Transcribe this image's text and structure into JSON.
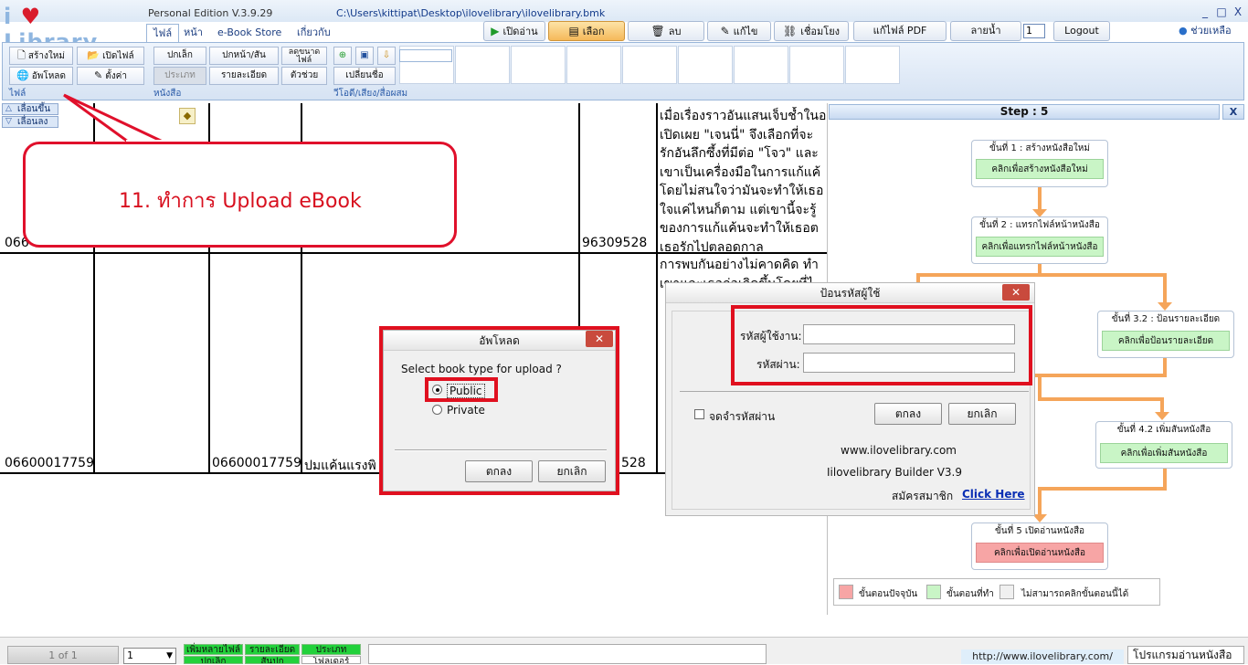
{
  "app": {
    "logo_prefix": "i",
    "logo_word": "Library",
    "edition": "Personal Edition V.3.9.29",
    "file_path": "C:\\Users\\kittipat\\Desktop\\ilovelibrary\\ilovelibrary.bmk",
    "win_minimize": "_",
    "win_restore": "□",
    "win_close": "X"
  },
  "tabs": [
    "ไฟล์",
    "หน้า",
    "e-Book Store",
    "เกี่ยวกับ"
  ],
  "toolbar": {
    "open_read": "เปิดอ่าน",
    "select": "เลือก",
    "delete": "ลบ",
    "edit": "แก้ไข",
    "link": "เชื่อมโยง",
    "edit_pdf": "แก้ไฟล์ PDF",
    "watermark": "ลายน้ำ",
    "page_value": "1",
    "logout": "Logout",
    "help": "ช่วยเหลือ"
  },
  "ribbon": {
    "file_group": {
      "label": "ไฟล์",
      "new": "สร้างใหม่",
      "open": "เปิดไฟล์",
      "upload": "อัพโหลด",
      "settings": "ตั้งค่า"
    },
    "book_group": {
      "label": "หนังสือ",
      "small": "ปกเล็ก",
      "cover": "ปกหน้า/สัน",
      "shrink": "ลดขนาด ไฟล์",
      "type": "ประเภท",
      "detail": "รายละเอียด",
      "helper": "ตัวช่วย"
    },
    "media_group": {
      "label": "วีโอดี/เสียง/สื่อผสม",
      "rename": "เปลี่ยนชื่อ"
    }
  },
  "grid": {
    "move_up": "เลื่อนขึ้น",
    "move_down": "เลื่อนลง",
    "row1_code": "066",
    "row1_barcode": "96309528",
    "row2_code_a": "06600017759",
    "row2_code_b": "06600017759",
    "row2_title": "ปมแค้นแรงพิ",
    "row2_barcode": "528",
    "desc_lines": [
      "เมื่อเรื่องราวอันแสนเจ็บช้ำในอ",
      "เปิดเผย \"เจนนี่\" จึงเลือกที่จะ",
      "รักอันลึกซึ้งที่มีต่อ \"โจว\" และ",
      "เขาเป็นเครื่องมือในการแก้แค้",
      "โดยไม่สนใจว่ามันจะทำให้เธอ",
      "ใจแค่ไหนก็ตาม แต่เขานี้จะรู้",
      "ของการแก้แค้นจะทำให้เธอต",
      "เธอรักไปตลอดกาล"
    ],
    "desc2_first": "การพบกันอย่างไม่คาดคิด ทำ",
    "desc2_second": "เขาและเธอก่อเกิดขึ้นโดยที่ไ"
  },
  "callout": {
    "text": "11. ทำการ Upload eBook"
  },
  "upload_dialog": {
    "title": "อัพโหลด",
    "close": "✕",
    "prompt": "Select book type for upload ?",
    "options": [
      "Public",
      "Private"
    ],
    "selected": "Public",
    "ok": "ตกลง",
    "cancel": "ยกเลิก"
  },
  "login_dialog": {
    "title": "ป้อนรหัสผู้ใช้",
    "close": "✕",
    "username_label": "รหัสผู้ใช้งาน:",
    "username_value": "",
    "password_label": "รหัสผ่าน:",
    "password_value": "",
    "remember": "จดจำรหัสผ่าน",
    "ok": "ตกลง",
    "cancel": "ยกเลิก",
    "site": "www.ilovelibrary.com",
    "version": "Iilovelibrary Builder V3.9",
    "register_label": "สมัครสมาชิก",
    "click_here": "Click Here"
  },
  "steps": {
    "header": "Step : 5",
    "close": "X",
    "items": [
      {
        "title": "ขั้นที่ 1 : สร้างหนังสือใหม่",
        "button": "คลิกเพื่อสร้างหนังสือใหม่"
      },
      {
        "title": "ขั้นที่ 2 : แทรกไฟล์หน้าหนังสือ",
        "button": "คลิกเพื่อแทรกไฟล์หน้าหนังสือ"
      },
      {
        "title": "ขั้นที่ 3.2 : ป้อนรายละเอียด",
        "button": "คลิกเพื่อป้อนรายละเอียด"
      },
      {
        "title": "ขั้นที่ 4.2 เพิ่มสันหนังสือ",
        "button": "คลิกเพื่อเพิ่มสันหนังสือ"
      },
      {
        "title": "ขั้นที่ 5 เปิดอ่านหนังสือ",
        "button": "คลิกเพื่อเปิดอ่านหนังสือ"
      }
    ],
    "legend": {
      "current": "ขั้นตอนปัจจุบัน",
      "done": "ขั้นตอนที่ทำ",
      "disabled": "ไม่สามารถคลิกขั้นตอนนี้ได้"
    },
    "colors": {
      "current": "#f7a5a5",
      "done": "#c9f5c6",
      "disabled": "#f0f0f0",
      "arrow": "#f5a55a"
    }
  },
  "bottom": {
    "pages": "1 of 1",
    "zoom": "1",
    "chip_add": "เพิ่มหลายไฟล์",
    "chip_detail": "รายละเอียด",
    "chip_type": "ประเภท",
    "chip_small": "ปกเล็ก",
    "chip_spine": "สันปก",
    "chip_folder": "โฟลเดอร์",
    "url": "http://www.ilovelibrary.com/",
    "reader": "โปรแกรมอ่านหนังสือ"
  }
}
